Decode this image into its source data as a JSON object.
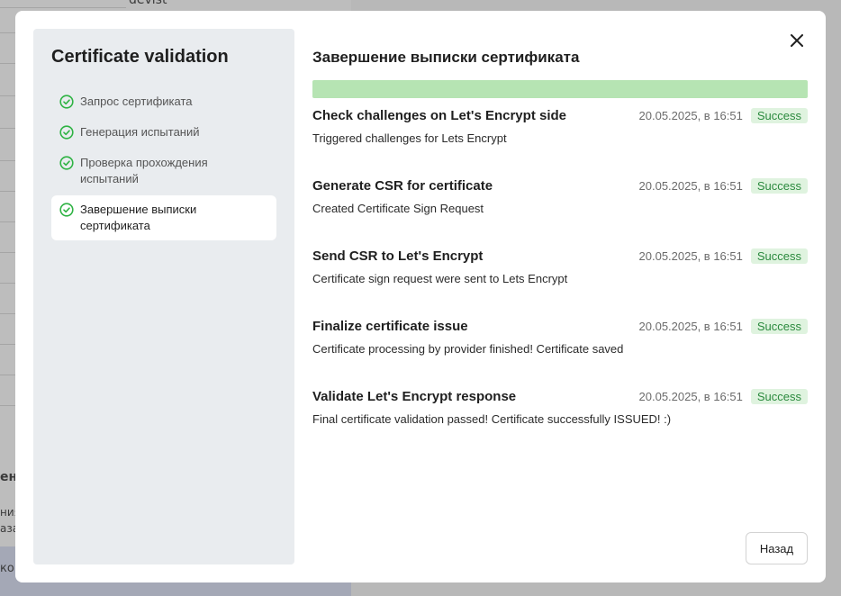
{
  "background": {
    "snippets": [
      "devist",
      "ени",
      "ния",
      "аза",
      "ко с"
    ]
  },
  "modal": {
    "left": {
      "title": "Certificate validation",
      "steps": [
        {
          "label": "Запрос сертификата",
          "active": false
        },
        {
          "label": "Генерация испытаний",
          "active": false
        },
        {
          "label": "Проверка прохождения испытаний",
          "active": false
        },
        {
          "label": "Завершение выписки сертификата",
          "active": true
        }
      ]
    },
    "right": {
      "title": "Завершение выписки сертификата",
      "progress": 1.0,
      "logs": [
        {
          "title": "Check challenges on Let's Encrypt side",
          "time": "20.05.2025, в 16:51",
          "status": "Success",
          "description": "Triggered challenges for Lets Encrypt"
        },
        {
          "title": "Generate CSR for certificate",
          "time": "20.05.2025, в 16:51",
          "status": "Success",
          "description": "Created Certificate Sign Request"
        },
        {
          "title": "Send CSR to Let's Encrypt",
          "time": "20.05.2025, в 16:51",
          "status": "Success",
          "description": "Certificate sign request were sent to Lets Encrypt"
        },
        {
          "title": "Finalize certificate issue",
          "time": "20.05.2025, в 16:51",
          "status": "Success",
          "description": "Certificate processing by provider finished! Certificate saved"
        },
        {
          "title": "Validate Let's Encrypt response",
          "time": "20.05.2025, в 16:51",
          "status": "Success",
          "description": "Final certificate validation passed! Certificate successfully ISSUED! :)"
        }
      ],
      "back_label": "Назад"
    },
    "icons": {
      "close": "close-icon",
      "step_done": "check-circle-icon"
    },
    "colors": {
      "success_text": "#2b8a3e",
      "success_bg": "#dff3df",
      "progress_fill": "#b6e4b3",
      "step_icon": "#2fb344"
    }
  }
}
